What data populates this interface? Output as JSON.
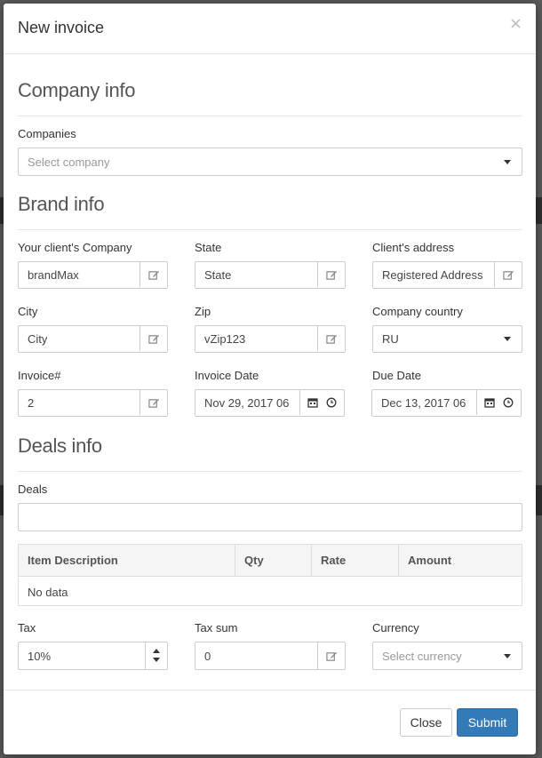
{
  "modal": {
    "title": "New invoice",
    "close_glyph": "×"
  },
  "company_info": {
    "section_title": "Company info",
    "companies_label": "Companies",
    "companies_placeholder": "Select company"
  },
  "brand_info": {
    "section_title": "Brand info",
    "client_company_label": "Your client's Company",
    "client_company_value": "brandMax",
    "state_label": "State",
    "state_value": "State",
    "address_label": "Client's address",
    "address_value": "Registered Address",
    "city_label": "City",
    "city_value": "City",
    "zip_label": "Zip",
    "zip_value": "vZip123",
    "country_label": "Company country",
    "country_value": "RU",
    "invoice_no_label": "Invoice#",
    "invoice_no_value": "2",
    "invoice_date_label": "Invoice Date",
    "invoice_date_value": "Nov 29, 2017 06",
    "due_date_label": "Due Date",
    "due_date_value": "Dec 13, 2017 06"
  },
  "deals_info": {
    "section_title": "Deals info",
    "deals_label": "Deals",
    "deals_value": "",
    "table": {
      "columns": [
        "Item Description",
        "Qty",
        "Rate",
        "Amount"
      ],
      "empty_text": "No data"
    }
  },
  "totals": {
    "tax_label": "Tax",
    "tax_value": "10%",
    "tax_sum_label": "Tax sum",
    "tax_sum_value": "0",
    "currency_label": "Currency",
    "currency_placeholder": "Select currency"
  },
  "footer": {
    "close_label": "Close",
    "submit_label": "Submit"
  },
  "colors": {
    "primary": "#337ab7",
    "border": "#cccccc"
  },
  "icons": {
    "edit": "edit-icon",
    "calendar": "calendar-icon",
    "clock": "clock-icon",
    "dropdown": "caret-down-icon"
  }
}
